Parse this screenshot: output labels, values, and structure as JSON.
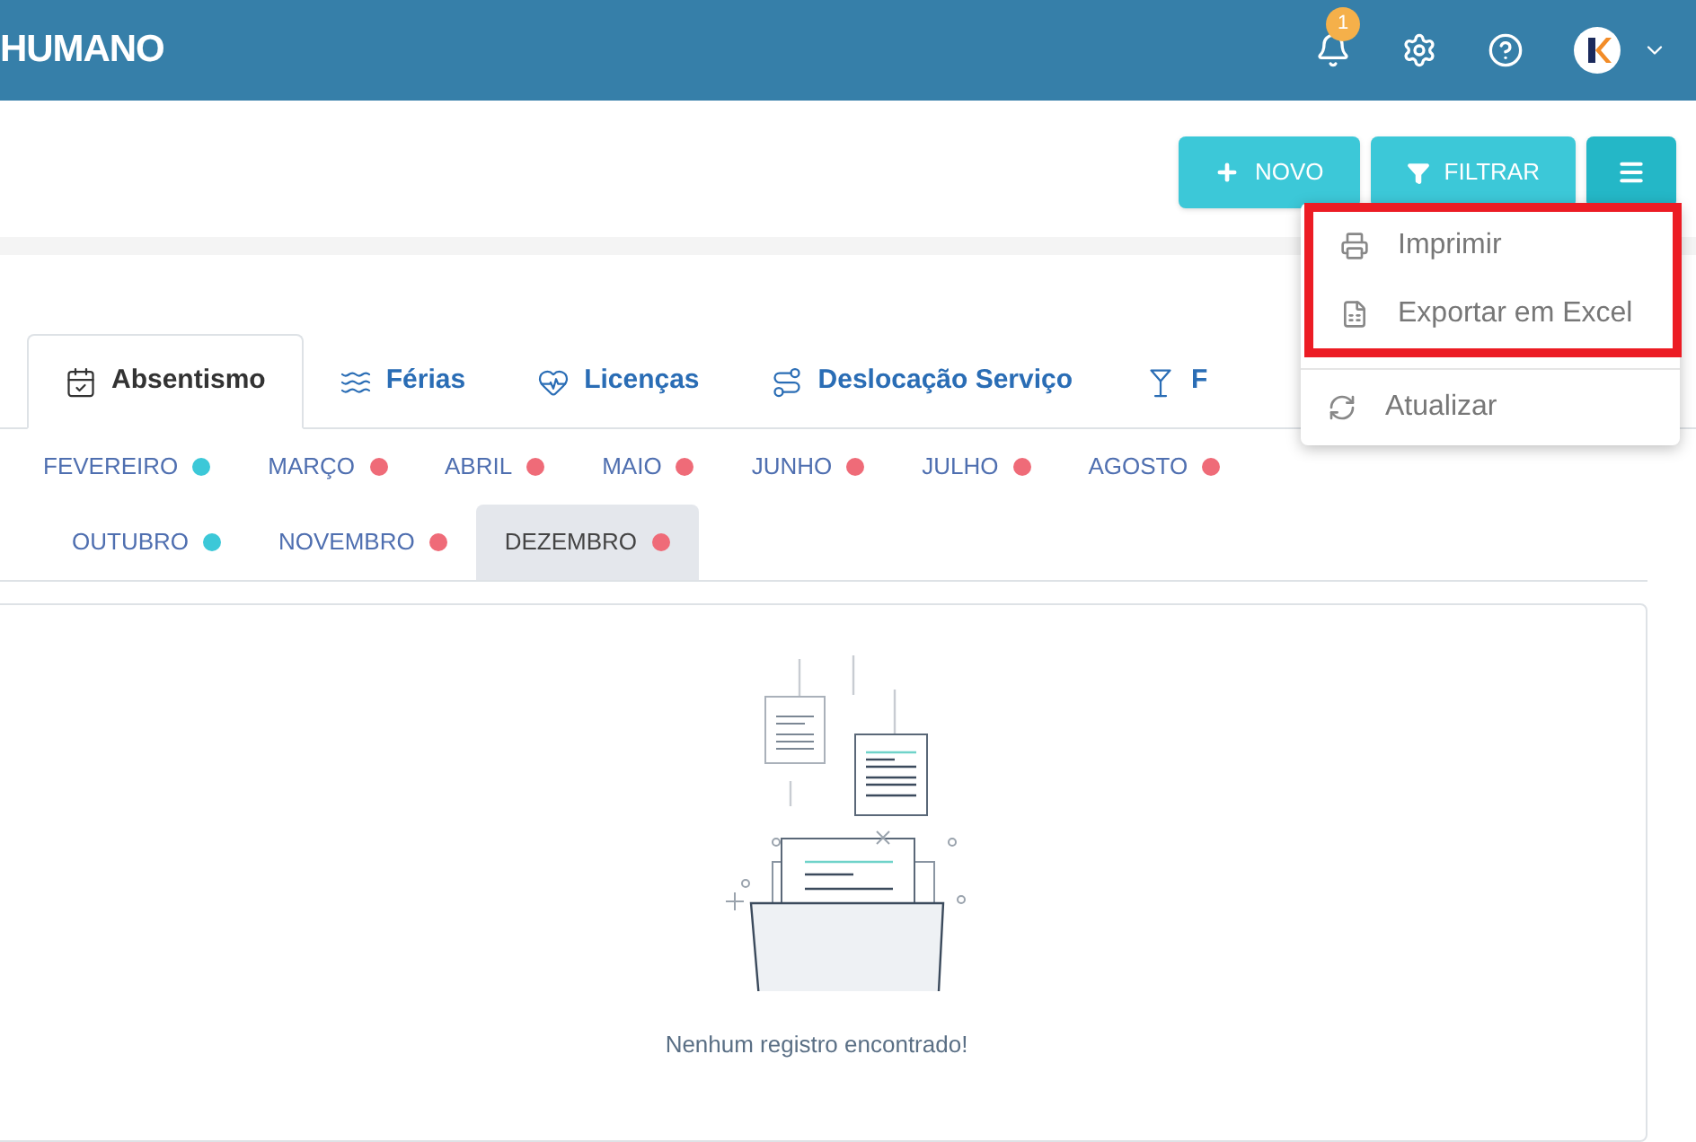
{
  "header": {
    "title": "HUMANO",
    "notification_count": "1"
  },
  "actions": [
    {
      "kind": "new",
      "label": "NOVO"
    },
    {
      "kind": "filter",
      "label": "FILTRAR"
    },
    {
      "kind": "menu"
    }
  ],
  "menu": {
    "groups": [
      {
        "highlighted": true,
        "items": [
          {
            "kind": "print",
            "label": "Imprimir"
          },
          {
            "kind": "excel",
            "label": "Exportar em Excel"
          }
        ]
      },
      {
        "highlighted": false,
        "items": [
          {
            "kind": "refresh",
            "label": "Atualizar"
          }
        ]
      }
    ]
  },
  "tabs": [
    {
      "kind": "calendar",
      "label": "Absentismo",
      "selected": true
    },
    {
      "kind": "swim",
      "label": "Férias",
      "selected": false
    },
    {
      "kind": "heart",
      "label": "Licenças",
      "selected": false
    },
    {
      "kind": "route",
      "label": "Deslocação Serviço",
      "selected": false
    },
    {
      "kind": "cocktail",
      "label": "F",
      "selected": false
    }
  ],
  "month_rows": [
    [
      {
        "label": "FEVEREIRO",
        "color": "#3cc8d8",
        "selected": false
      },
      {
        "label": "MARÇO",
        "color": "#ef6b78",
        "selected": false
      },
      {
        "label": "ABRIL",
        "color": "#ef6b78",
        "selected": false
      },
      {
        "label": "MAIO",
        "color": "#ef6b78",
        "selected": false
      },
      {
        "label": "JUNHO",
        "color": "#ef6b78",
        "selected": false
      },
      {
        "label": "JULHO",
        "color": "#ef6b78",
        "selected": false
      },
      {
        "label": "AGOSTO",
        "color": "#ef6b78",
        "selected": false
      }
    ],
    [
      {
        "label": "OUTUBRO",
        "color": "#3cc8d8",
        "selected": false
      },
      {
        "label": "NOVEMBRO",
        "color": "#ef6b78",
        "selected": false
      },
      {
        "label": "DEZEMBRO",
        "color": "#ef6b78",
        "selected": true
      }
    ]
  ],
  "empty_state": {
    "message": "Nenhum registro encontrado!"
  }
}
